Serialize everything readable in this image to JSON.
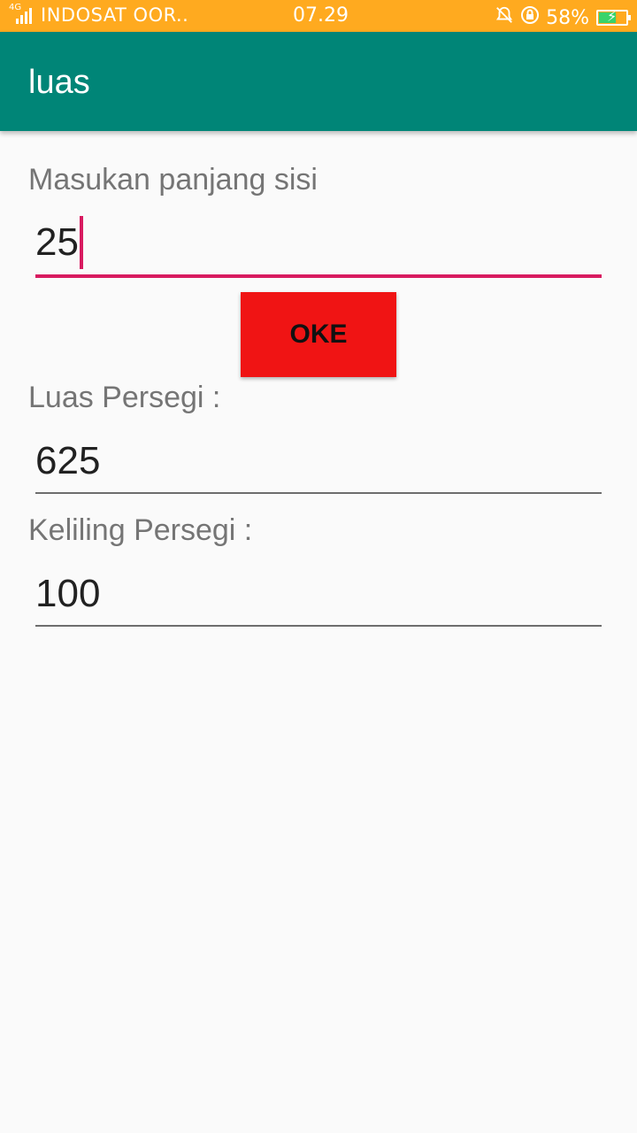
{
  "status_bar": {
    "network_type": "4G",
    "carrier": "INDOSAT OOR..",
    "time": "07.29",
    "battery_percent": "58%",
    "icons": [
      "signal-icon",
      "bell-muted-icon",
      "rotation-lock-icon",
      "battery-charging-icon"
    ]
  },
  "app_bar": {
    "title": "luas",
    "color": "#008577"
  },
  "form": {
    "side_label": "Masukan panjang sisi",
    "side_value": "25",
    "button_label": "OKE",
    "button_color": "#f01414",
    "area_label": "Luas Persegi :",
    "area_value": "625",
    "perimeter_label": "Keliling Persegi :",
    "perimeter_value": "100",
    "accent_color": "#d81b60"
  }
}
